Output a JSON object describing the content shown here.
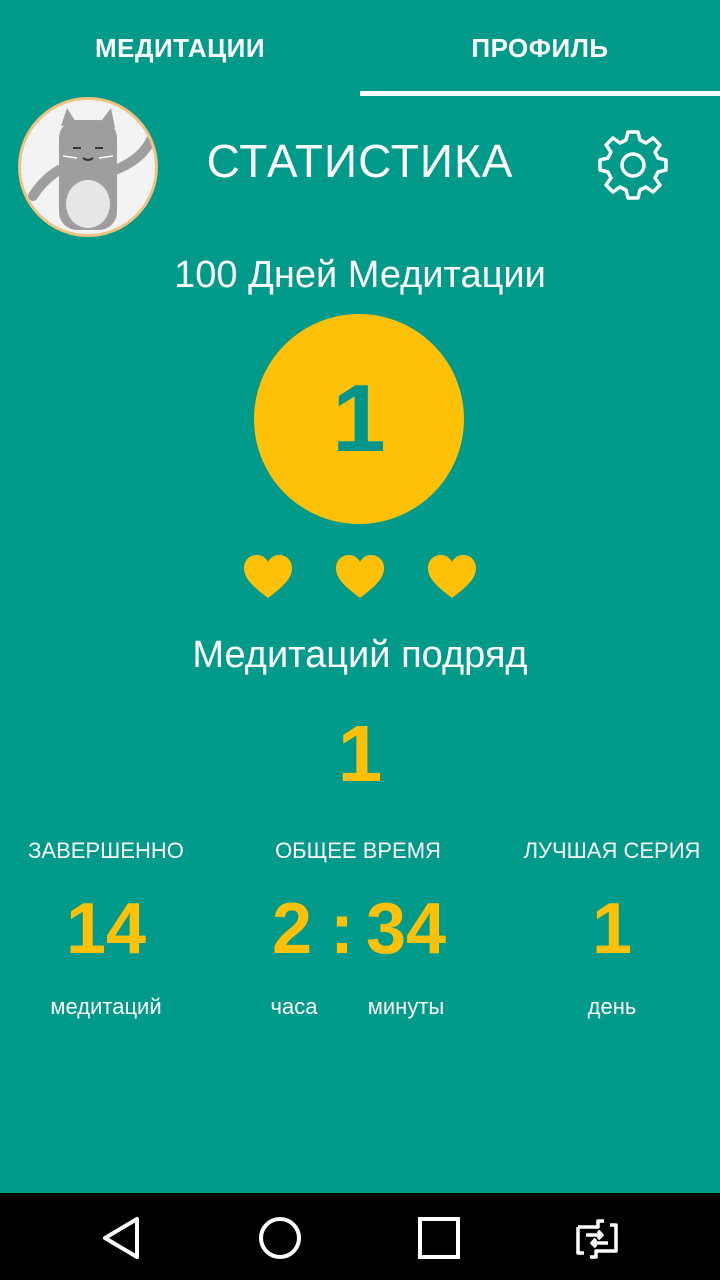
{
  "tabs": [
    {
      "label": "МЕДИТАЦИИ"
    },
    {
      "label": "ПРОФИЛЬ"
    }
  ],
  "header": {
    "title": "СТАТИСТИКА",
    "settings_icon": "gear-icon"
  },
  "goal": {
    "label": "100 Дней Медитации",
    "day": "1",
    "hearts_count": 3
  },
  "streak": {
    "label": "Медитаций подряд",
    "value": "1"
  },
  "stats": {
    "completed": {
      "header": "ЗАВЕРШЕННО",
      "value": "14",
      "unit": "медитаций"
    },
    "total_time": {
      "header": "ОБЩЕЕ ВРЕМЯ",
      "hours": "2",
      "separator": ":",
      "minutes": "34",
      "hours_unit": "часа",
      "minutes_unit": "минуты"
    },
    "best_streak": {
      "header": "ЛУЧШАЯ СЕРИЯ",
      "value": "1",
      "unit": "день"
    }
  },
  "colors": {
    "background": "#009a8a",
    "accent": "#ffc107",
    "text": "#ffffff"
  },
  "navbar": {
    "icons": [
      "back-icon",
      "home-icon",
      "recents-icon",
      "rotate-icon"
    ]
  }
}
